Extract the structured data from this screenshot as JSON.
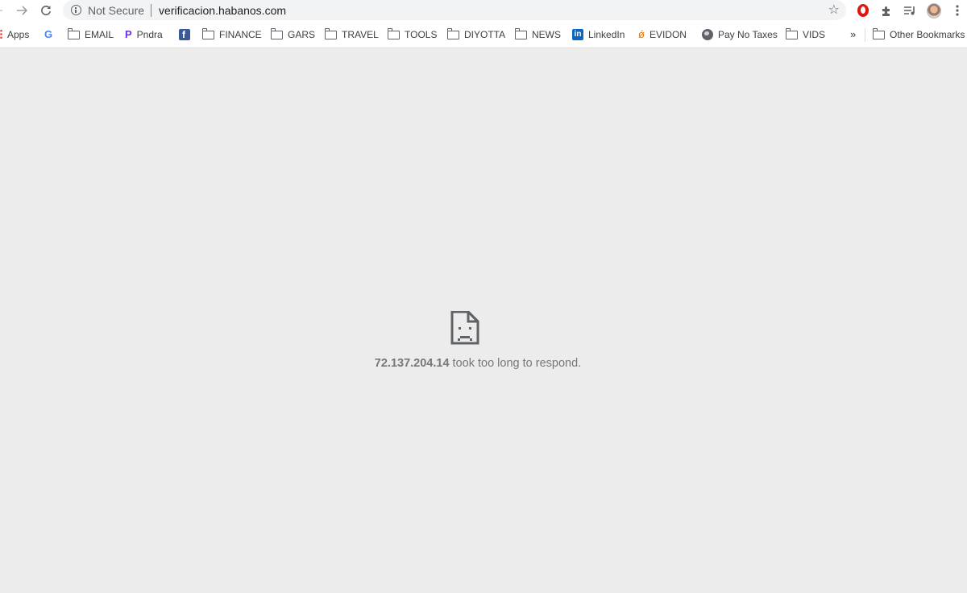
{
  "toolbar": {
    "back_icon": "back-arrow-icon",
    "forward_glyph": "→",
    "reload_glyph": "↻",
    "security_label": "Not Secure",
    "url": "verificacion.habanos.com",
    "star_glyph": "☆"
  },
  "bookmarks": [
    {
      "label": "Apps",
      "icon": "apps-grid-icon"
    },
    {
      "label": "",
      "icon": "google-icon"
    },
    {
      "label": "EMAIL",
      "icon": "folder-icon"
    },
    {
      "label": "Pndra",
      "icon": "pandora-icon"
    },
    {
      "label": "",
      "icon": "facebook-icon"
    },
    {
      "label": "FINANCE",
      "icon": "folder-icon"
    },
    {
      "label": "GARS",
      "icon": "folder-icon"
    },
    {
      "label": "TRAVEL",
      "icon": "folder-icon"
    },
    {
      "label": "TOOLS",
      "icon": "folder-icon"
    },
    {
      "label": "DIYOTTA",
      "icon": "folder-icon"
    },
    {
      "label": "NEWS",
      "icon": "folder-icon"
    },
    {
      "label": "LinkedIn",
      "icon": "linkedin-icon"
    },
    {
      "label": "EVIDON",
      "icon": "evidon-icon"
    },
    {
      "label": "Pay No Taxes",
      "icon": "globe-icon"
    },
    {
      "label": "VIDS",
      "icon": "folder-icon"
    }
  ],
  "bookmarks_overflow": "»",
  "other_bookmarks": "Other Bookmarks",
  "error": {
    "host": "72.137.204.14",
    "message": " took too long to respond."
  }
}
